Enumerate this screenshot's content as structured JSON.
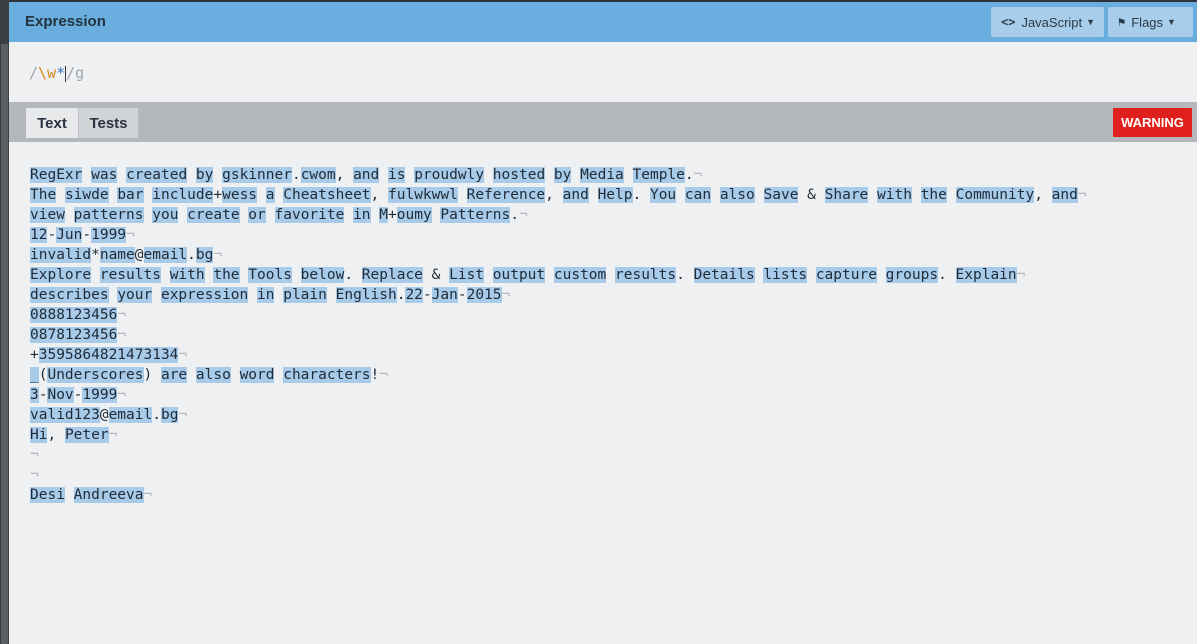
{
  "header": {
    "title": "Expression",
    "flavor_button": "JavaScript",
    "flags_button": "Flags"
  },
  "expression": {
    "open_delim": "/",
    "pattern_escape": "\\w",
    "pattern_quant": "*",
    "close_delim": "/",
    "flags": "g"
  },
  "tabs": {
    "text": "Text",
    "tests": "Tests",
    "warning": "WARNING"
  },
  "text_lines": [
    "RegExr was created by gskinner.cwom, and is proudwly hosted by Media Temple.",
    "The siwde bar include+wess a Cheatsheet, fulwkwwl Reference, and Help. You can also Save & Share with the Community, and",
    "view patterns you create or favorite in M+oumy Patterns.",
    "12-Jun-1999",
    "invalid*name@email.bg",
    "Explore results with the Tools below. Replace & List output custom results. Details lists capture groups. Explain",
    "describes your expression in plain English.22-Jan-2015",
    "0888123456",
    "0878123456",
    "+3595864821473134",
    "_(Underscores) are also word characters!",
    "3-Nov-1999",
    "valid123@email.bg",
    "Hi, Peter",
    "",
    "",
    "Desi Andreeva"
  ],
  "icons": {
    "flavor": "code-brackets-icon",
    "flags": "flag-icon",
    "caret": "caret-down-icon"
  },
  "colors": {
    "header_bg": "#6aaee0",
    "match_highlight": "#a9cbea",
    "warning_bg": "#e0201c"
  }
}
